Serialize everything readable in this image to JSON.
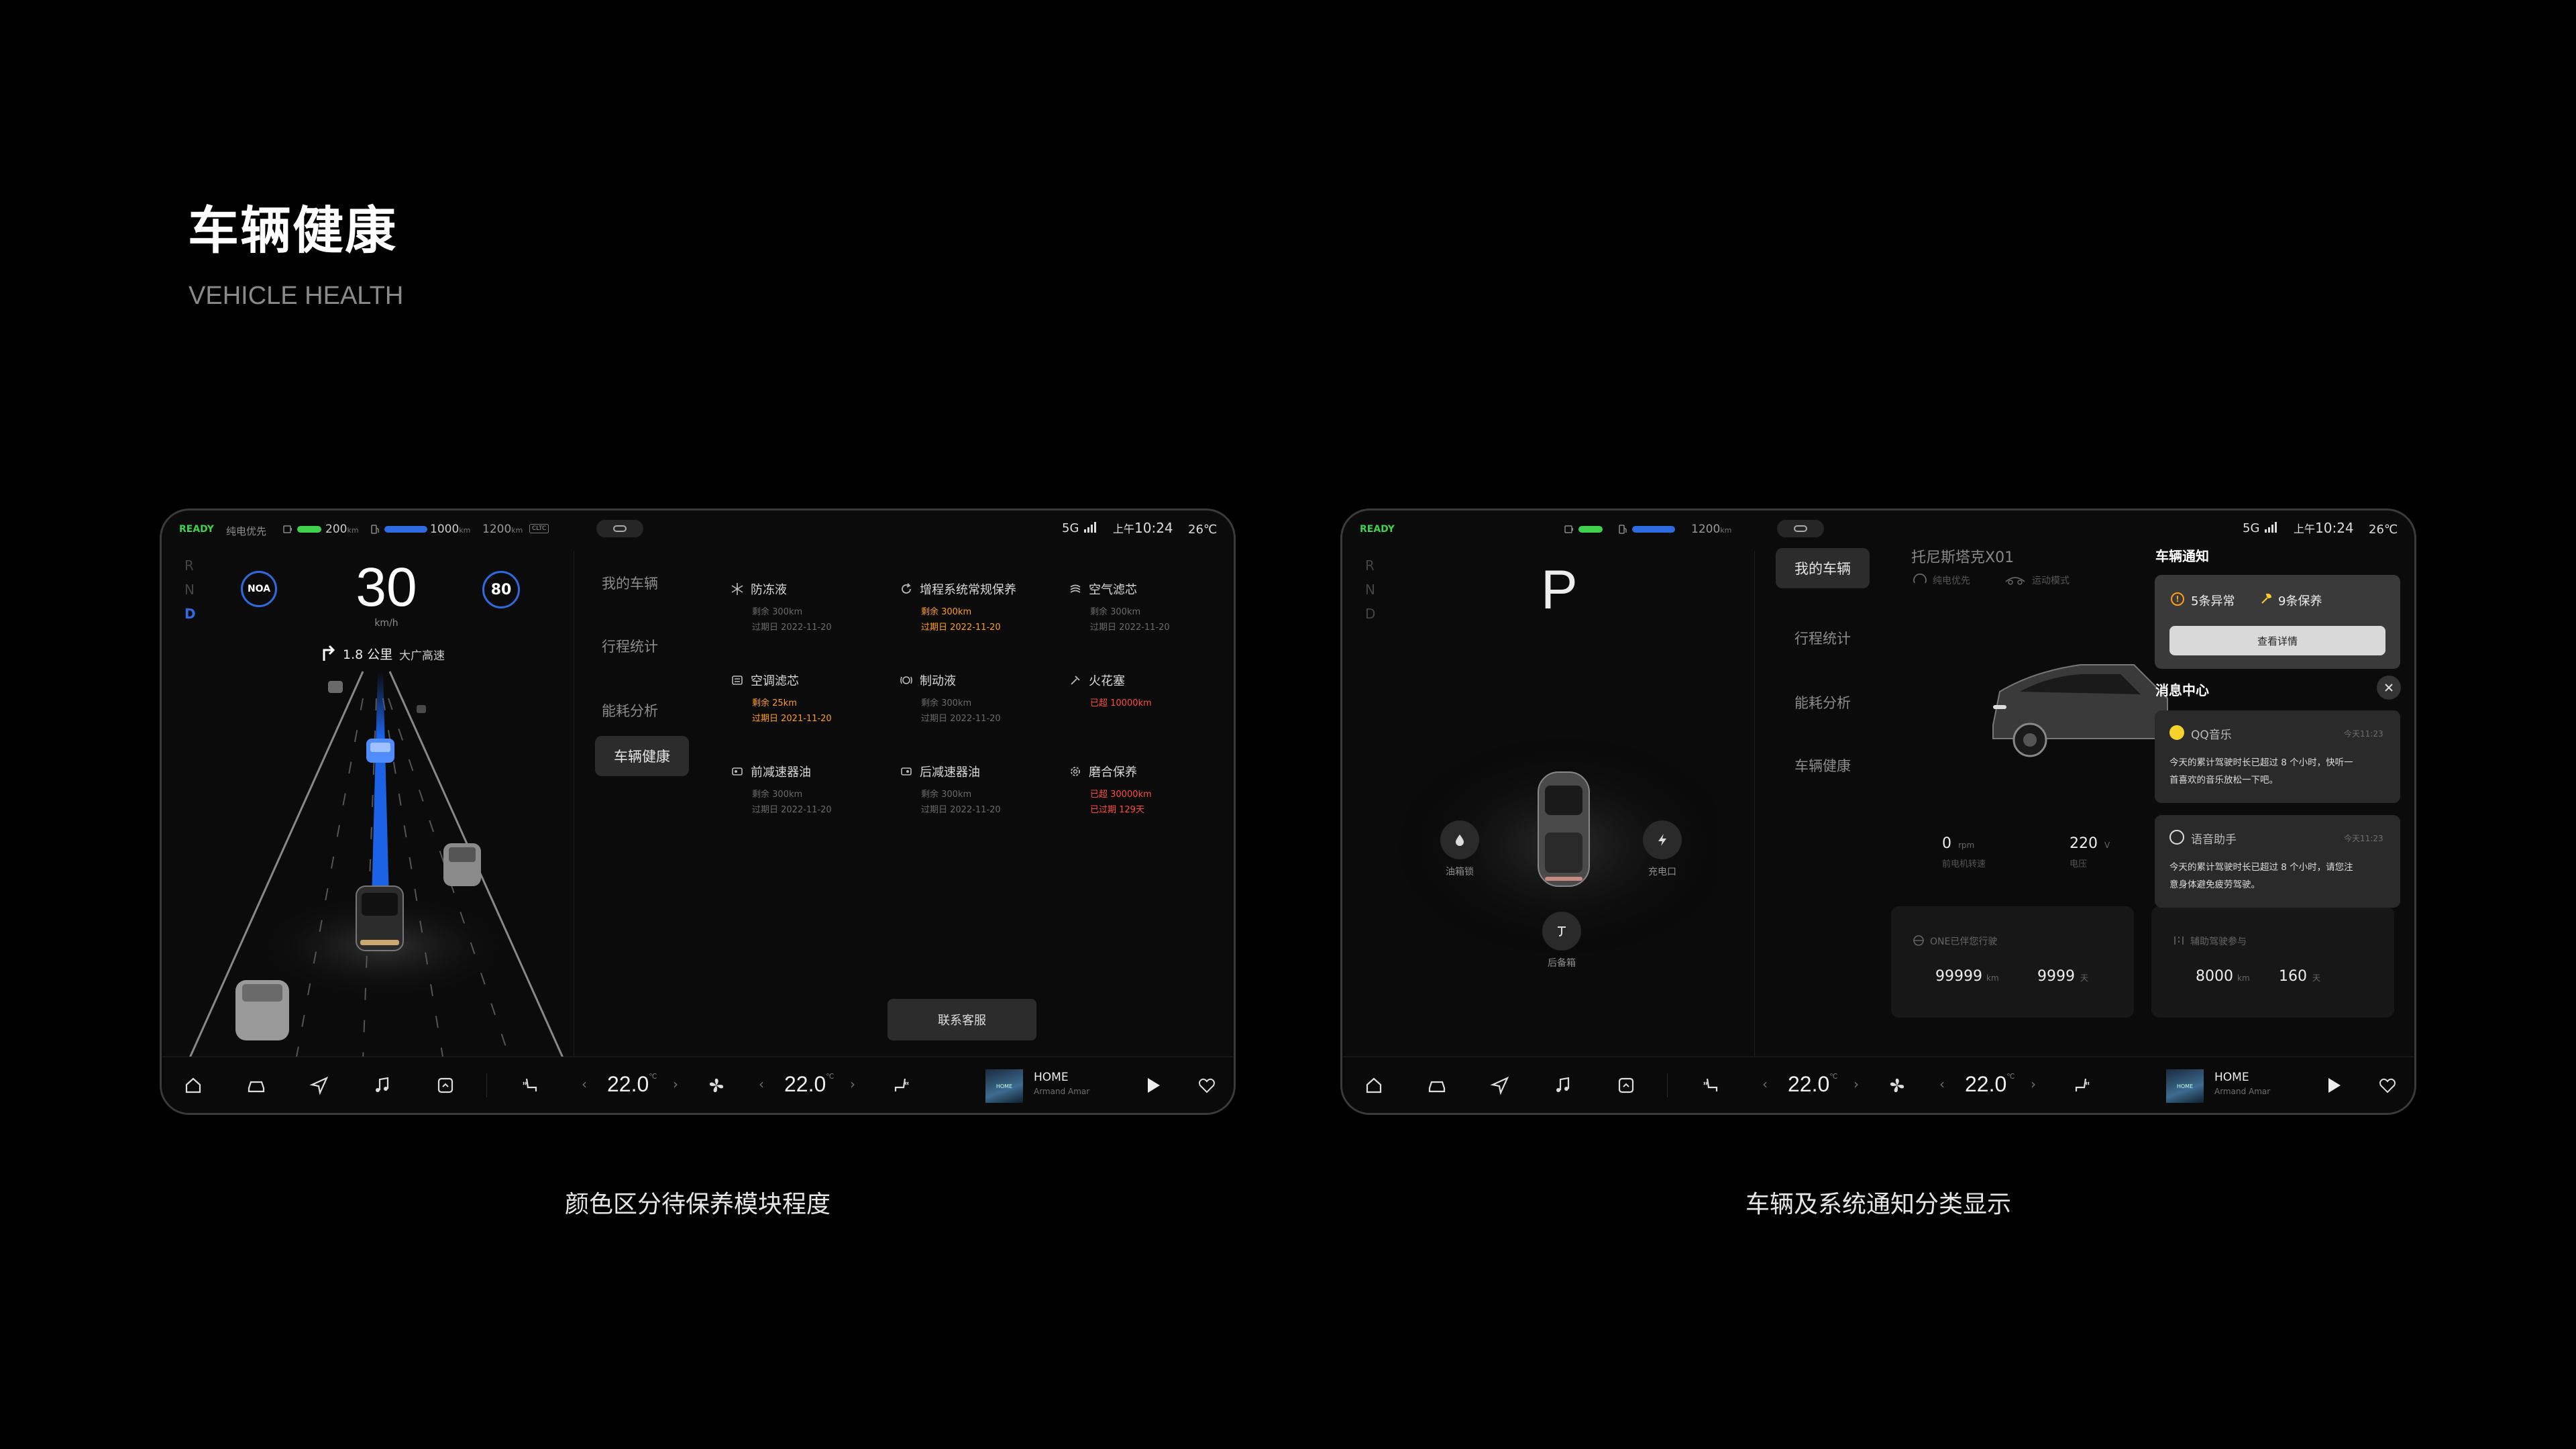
{
  "page": {
    "title": "车辆健康",
    "subtitle": "VEHICLE HEALTH",
    "caption_left": "颜色区分待保养模块程度",
    "caption_right": "车辆及系统通知分类显示"
  },
  "colors": {
    "ready": "#3ed14e",
    "battery": "#2f6be0",
    "green": "#3ed14e",
    "orange": "#ff9d18",
    "red": "#ff4a3d",
    "blue": "#1e6bff"
  },
  "left_screen": {
    "status": {
      "ready": "READY",
      "mode": "纯电优先",
      "ev_range": "200",
      "ev_unit": "km",
      "fuel_range": "1000",
      "fuel_unit": "km",
      "total_range": "1200",
      "total_unit": "km",
      "range_badge": "CLTC",
      "network": "5G",
      "time_prefix": "上午",
      "time": "10:24",
      "temp": "26℃"
    },
    "gears": [
      "R",
      "N",
      "D"
    ],
    "noa": "NOA",
    "speed": "30",
    "speed_unit": "km/h",
    "speed_limit": "80",
    "nav_distance": "1.8 公里",
    "nav_road": "大广高速",
    "menu": [
      "我的车辆",
      "行程统计",
      "能耗分析",
      "车辆健康"
    ],
    "maintenance": [
      {
        "name": "防冻液",
        "line1": "剩余 300km",
        "line2": "过期日 2022-11-20",
        "icon": "snowflake-icon",
        "status": "normal"
      },
      {
        "name": "增程系统常规保养",
        "line1": "剩余 300km",
        "line2": "过期日 2022-11-20",
        "icon": "refresh-icon",
        "status": "warning"
      },
      {
        "name": "空气滤芯",
        "line1": "剩余 300km",
        "line2": "过期日 2022-11-20",
        "icon": "air-filter-icon",
        "status": "normal"
      },
      {
        "name": "空调滤芯",
        "line1": "剩余 25km",
        "line2": "过期日 2021-11-20",
        "icon": "ac-filter-icon",
        "status": "warning"
      },
      {
        "name": "制动液",
        "line1": "剩余 300km",
        "line2": "过期日 2022-11-20",
        "icon": "brake-icon",
        "status": "normal"
      },
      {
        "name": "火花塞",
        "line1": "已超 10000km",
        "line2": "",
        "icon": "spark-plug-icon",
        "status": "overdue"
      },
      {
        "name": "前减速器油",
        "line1": "剩余 300km",
        "line2": "过期日 2022-11-20",
        "icon": "gear-oil-icon",
        "status": "normal"
      },
      {
        "name": "后减速器油",
        "line1": "剩余 300km",
        "line2": "过期日 2022-11-20",
        "icon": "gear-oil-icon",
        "status": "normal"
      },
      {
        "name": "磨合保养",
        "line1": "已超 30000km",
        "line2": "已过期 129天",
        "icon": "cog-icon",
        "status": "overdue"
      }
    ],
    "contact_button": "联系客服"
  },
  "right_screen": {
    "status": {
      "ready": "READY",
      "range": "1200",
      "range_unit": "km",
      "network": "5G",
      "time_prefix": "上午",
      "time": "10:24",
      "temp": "26℃"
    },
    "gears": [
      "R",
      "N",
      "D"
    ],
    "current_gear": "P",
    "car_buttons": [
      {
        "label": "油箱锁",
        "icon": "fuel-drop-icon"
      },
      {
        "label": "充电口",
        "icon": "bolt-icon"
      },
      {
        "label": "后备箱",
        "icon": "trunk-icon"
      }
    ],
    "menu": [
      "我的车辆",
      "行程统计",
      "能耗分析",
      "车辆健康"
    ],
    "vehicle_name": "托尼斯塔克X01",
    "vehicle_mode1": "纯电优先",
    "vehicle_mode2": "运动模式",
    "rpm_value": "0",
    "rpm_unit": "rpm",
    "rpm_label": "前电机转速",
    "voltage_value": "220",
    "voltage_unit": "V",
    "voltage_label": "电压",
    "card1_title": "ONE已伴您行驶",
    "card1_km": "99999",
    "card1_km_unit": "km",
    "card1_days": "9999",
    "card1_days_unit": "天",
    "card2_title": "辅助驾驶参与",
    "card2_km": "8000",
    "card2_km_unit": "km",
    "card2_days": "160",
    "card2_days_unit": "天",
    "vehicle_notice_title": "车辆通知",
    "abnormal": "5条异常",
    "maintain": "9条保养",
    "detail_button": "查看详情",
    "message_center_title": "消息中心",
    "messages": [
      {
        "app": "QQ音乐",
        "time": "今天11:23",
        "text1": "今天的累计驾驶时长已超过 8 个小时，快听一",
        "text2": "首喜欢的音乐放松一下吧。"
      },
      {
        "app": "语音助手",
        "time": "今天11:23",
        "text1": "今天的累计驾驶时长已超过 8 个小时，请您注",
        "text2": "意身体避免疲劳驾驶。"
      }
    ]
  },
  "bottom_bar": {
    "temp_left": "22.0",
    "temp_right": "22.0",
    "temp_unit": "℃",
    "media_title": "HOME",
    "media_artist": "Armand Amar",
    "cover_text": "HOME"
  }
}
